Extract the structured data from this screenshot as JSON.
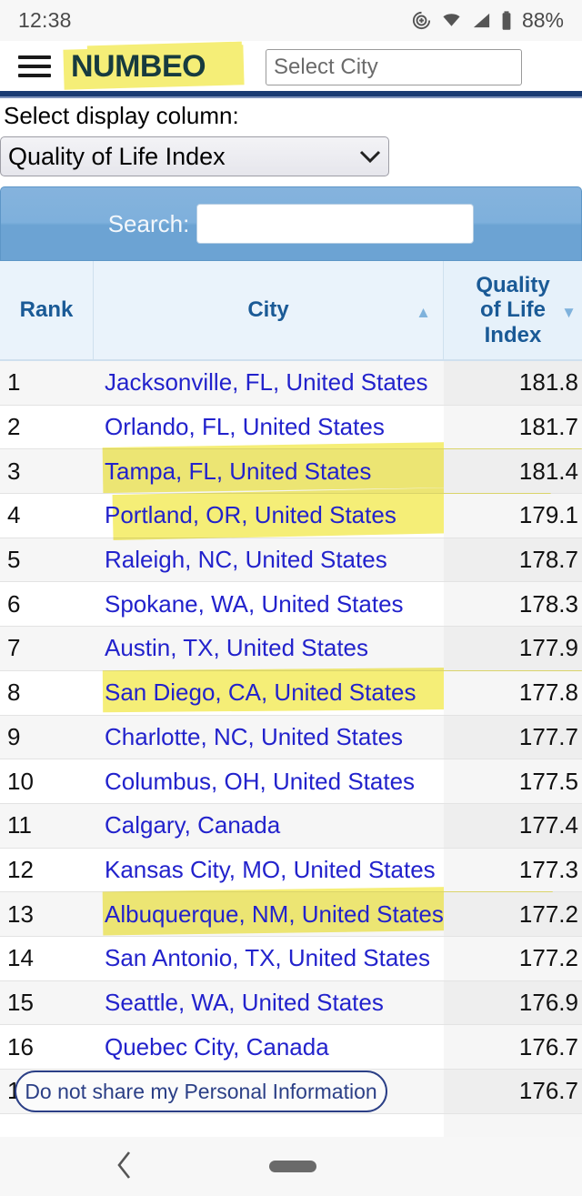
{
  "status_bar": {
    "time": "12:38",
    "battery_percent": "88%",
    "icons": [
      "data-saver-icon",
      "wifi-icon",
      "cellular-signal-icon",
      "battery-icon"
    ]
  },
  "header": {
    "menu_icon": "hamburger-menu-icon",
    "logo_text": "NUMBEO",
    "city_search_placeholder": "Select City",
    "city_search_value": ""
  },
  "controls": {
    "select_label": "Select display column:",
    "selected_column": "Quality of Life Index",
    "caret_icon": "chevron-down-icon",
    "search_label": "Search:",
    "search_value": "",
    "search_placeholder": ""
  },
  "table": {
    "columns": [
      {
        "key": "rank",
        "label": "Rank",
        "sort": "none"
      },
      {
        "key": "city",
        "label": "City",
        "sort": "asc",
        "sort_icon": "caret-up-icon"
      },
      {
        "key": "index",
        "label": "Quality of Life Index",
        "sort": "desc",
        "sort_icon": "caret-down-icon"
      }
    ],
    "rows": [
      {
        "rank": "1",
        "city": "Jacksonville, FL, United States",
        "index": "181.8",
        "highlight": null
      },
      {
        "rank": "2",
        "city": "Orlando, FL, United States",
        "index": "181.7",
        "highlight": null
      },
      {
        "rank": "3",
        "city": "Tampa, FL, United States",
        "index": "181.4",
        "highlight": "yellow"
      },
      {
        "rank": "4",
        "city": "Portland, OR, United States",
        "index": "179.1",
        "highlight": "yellow"
      },
      {
        "rank": "5",
        "city": "Raleigh, NC, United States",
        "index": "178.7",
        "highlight": null
      },
      {
        "rank": "6",
        "city": "Spokane, WA, United States",
        "index": "178.3",
        "highlight": null
      },
      {
        "rank": "7",
        "city": "Austin, TX, United States",
        "index": "177.9",
        "highlight": null
      },
      {
        "rank": "8",
        "city": "San Diego, CA, United States",
        "index": "177.8",
        "highlight": "yellow"
      },
      {
        "rank": "9",
        "city": "Charlotte, NC, United States",
        "index": "177.7",
        "highlight": null
      },
      {
        "rank": "10",
        "city": "Columbus, OH, United States",
        "index": "177.5",
        "highlight": null
      },
      {
        "rank": "11",
        "city": "Calgary, Canada",
        "index": "177.4",
        "highlight": null
      },
      {
        "rank": "12",
        "city": "Kansas City, MO, United States",
        "index": "177.3",
        "highlight": null
      },
      {
        "rank": "13",
        "city": "Albuquerque, NM, United States",
        "index": "177.2",
        "highlight": "yellow"
      },
      {
        "rank": "14",
        "city": "San Antonio, TX, United States",
        "index": "177.2",
        "highlight": null
      },
      {
        "rank": "15",
        "city": "Seattle, WA, United States",
        "index": "176.9",
        "highlight": null
      },
      {
        "rank": "16",
        "city": "Quebec City, Canada",
        "index": "176.7",
        "highlight": null
      },
      {
        "rank": "17",
        "city": "",
        "index": "176.7",
        "highlight": null
      }
    ]
  },
  "privacy_banner": {
    "label": "Do not share my Personal Information"
  },
  "nav_bar": {
    "back_icon": "chevron-left-icon",
    "home_pill_icon": "home-pill-icon"
  },
  "colors": {
    "brand_navy": "#1b3c73",
    "logo_teal": "#173b3f",
    "highlight_yellow": "#f5ee77",
    "link_blue": "#2222cc",
    "header_blue": "#1a5a96",
    "search_band": "#6ca3d3"
  }
}
